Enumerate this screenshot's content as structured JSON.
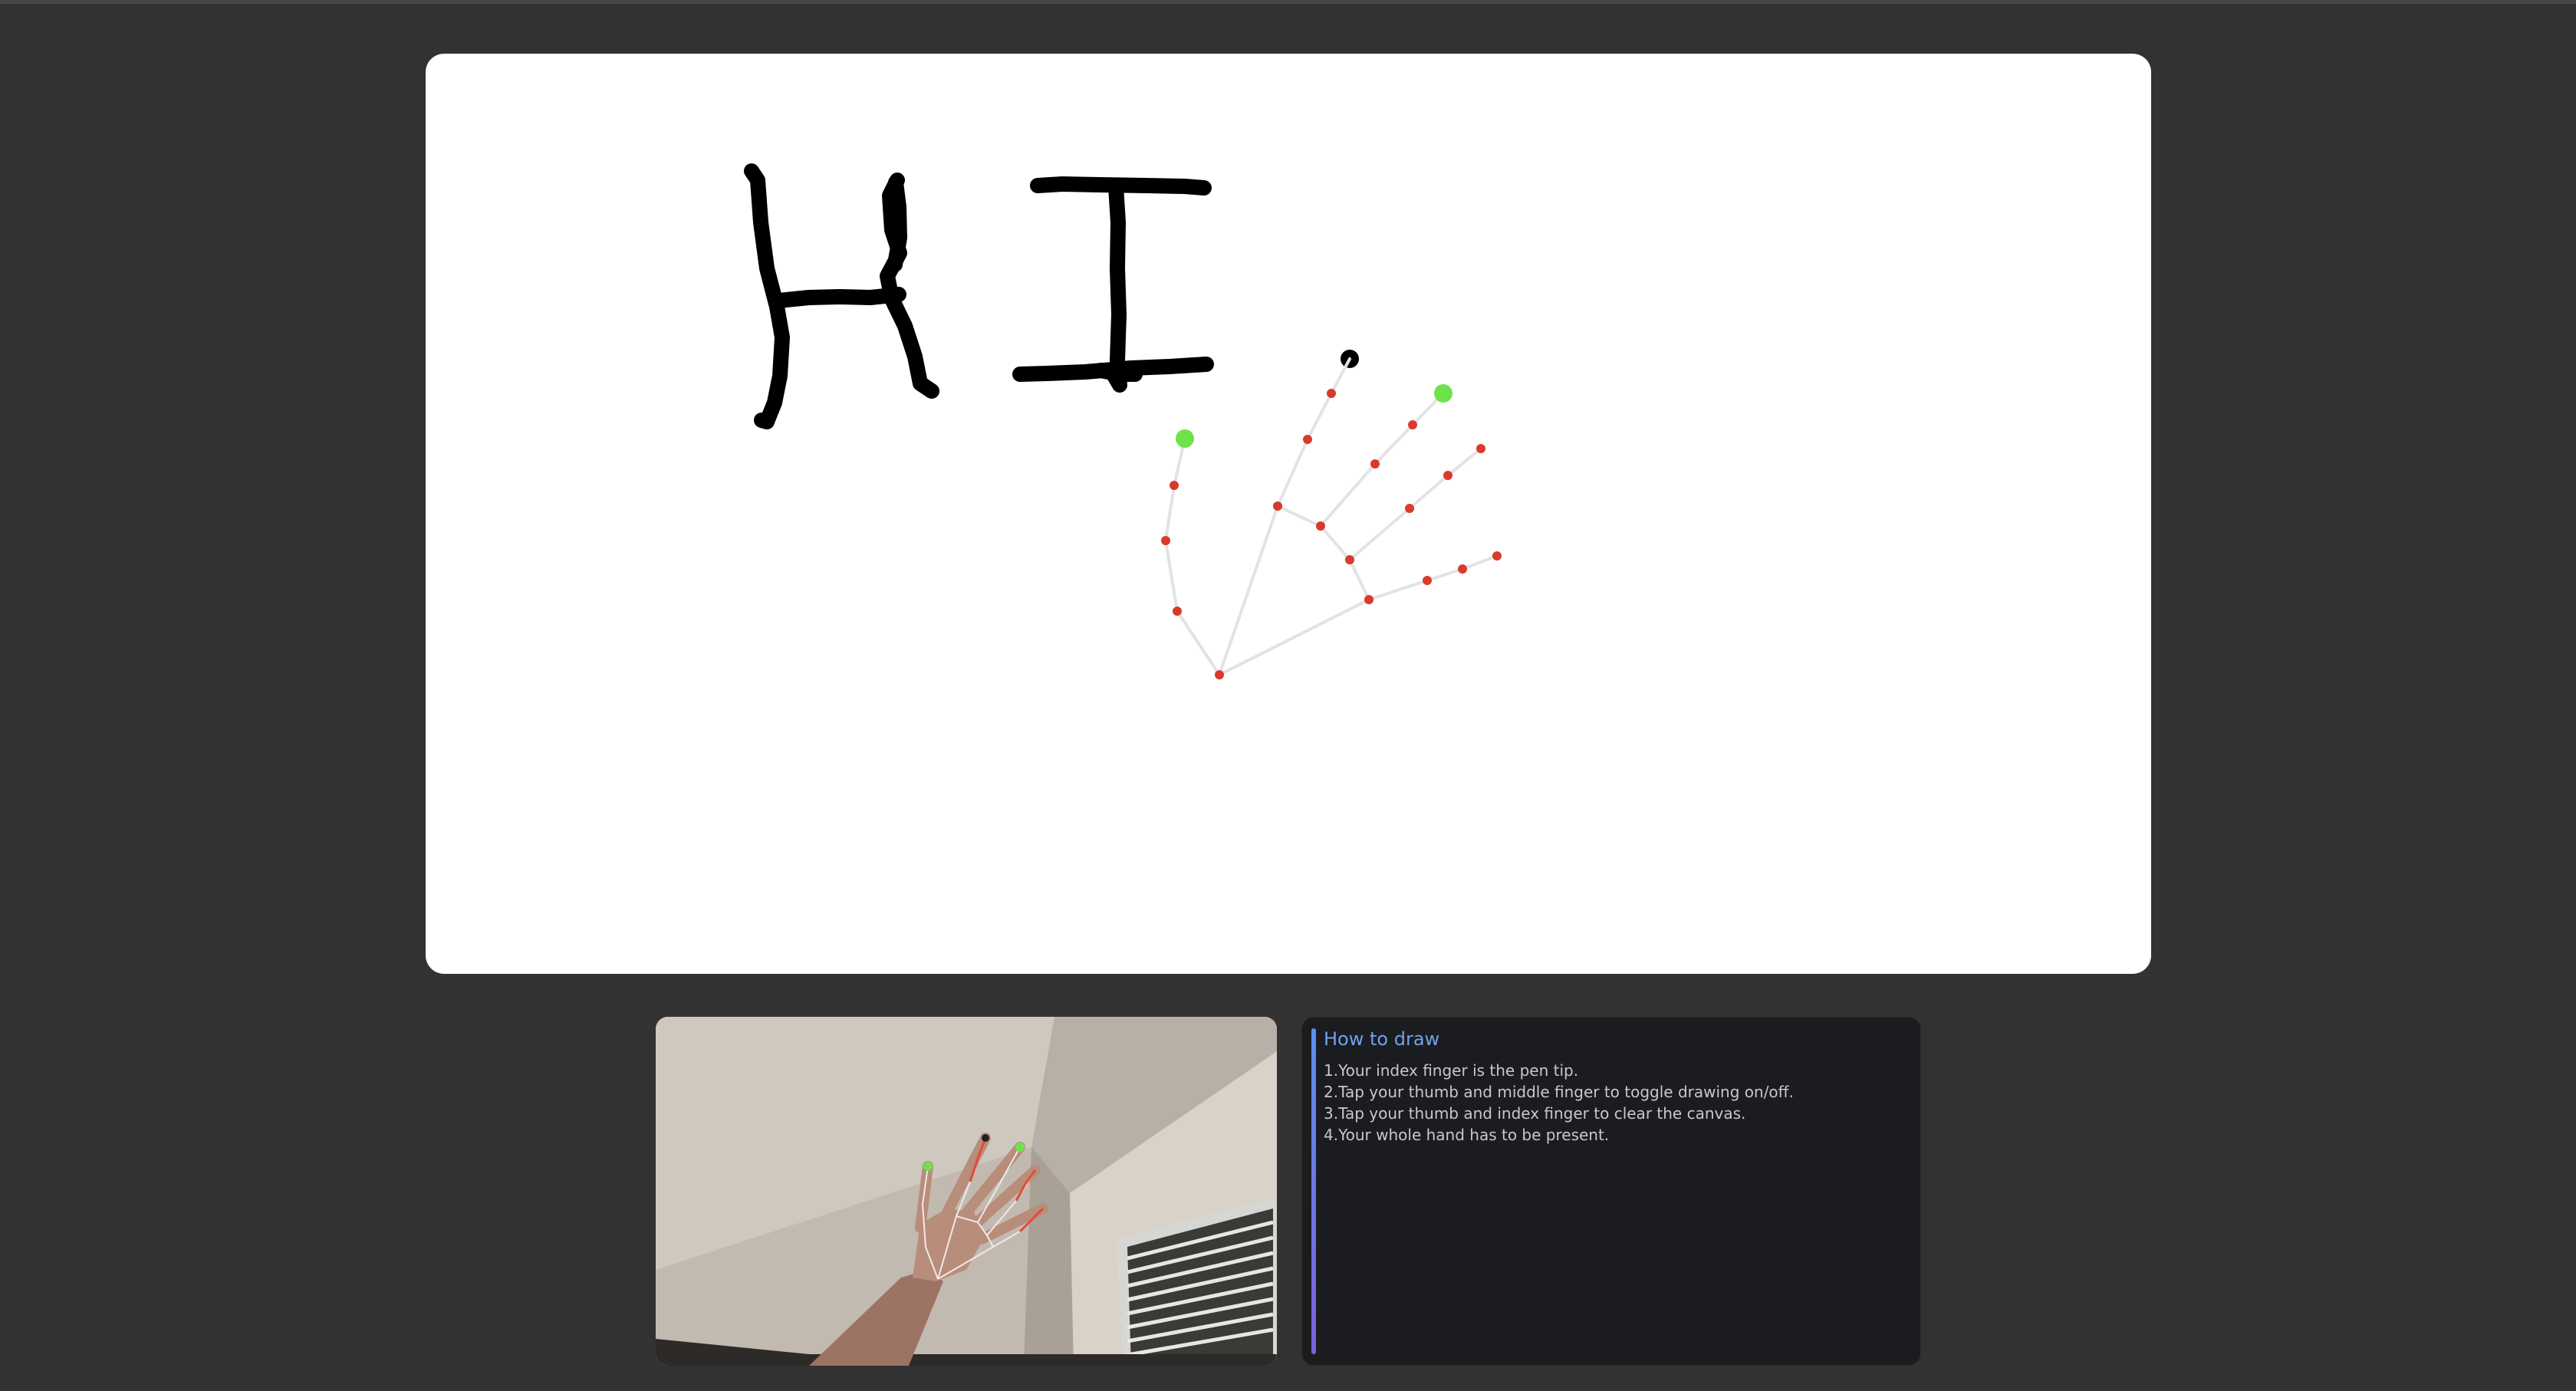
{
  "canvas": {
    "drawn_text": "HI",
    "stroke_color": "#000000",
    "landmark_color": "#d93a2b",
    "fingertip_color": "#6fe24a",
    "skeleton_color": "#e3e3e3"
  },
  "instructions": {
    "title": "How to draw",
    "items": [
      "1.Your index finger is the pen tip.",
      "2.Tap your thumb and middle finger to toggle drawing on/off.",
      "3.Tap your thumb and index finger to clear the canvas.",
      "4.Your whole hand has to be present."
    ],
    "accent_colors": [
      "#5b8ff0",
      "#7c5fe0"
    ]
  },
  "webcam": {
    "label": "webcam-feed"
  }
}
